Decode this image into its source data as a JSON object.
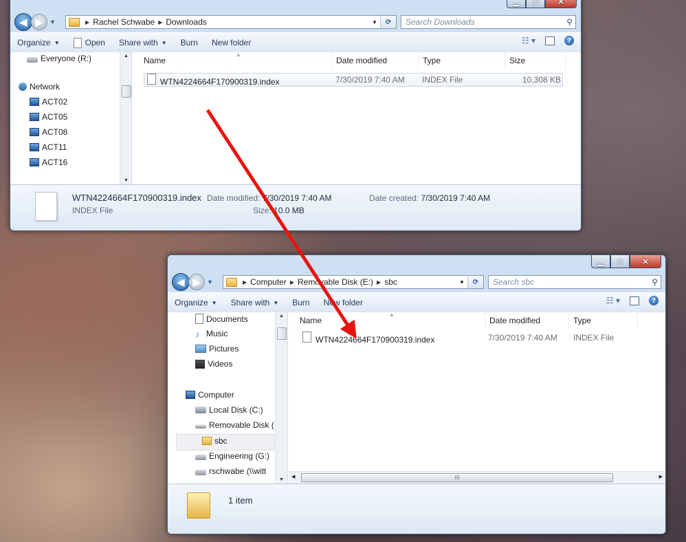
{
  "downloads_window": {
    "address": {
      "parts": [
        "Rachel Schwabe",
        "Downloads"
      ]
    },
    "search_placeholder": "Search Downloads",
    "toolbar": {
      "organize": "Organize",
      "open": "Open",
      "share_with": "Share with",
      "burn": "Burn",
      "new_folder": "New folder"
    },
    "nav_items": [
      {
        "label": "Everyone (R:)",
        "icon": "network-drive-icon"
      },
      {
        "label": "Network",
        "icon": "network-icon"
      },
      {
        "label": "ACT02",
        "icon": "computer-icon"
      },
      {
        "label": "ACT05",
        "icon": "computer-icon"
      },
      {
        "label": "ACT08",
        "icon": "computer-icon"
      },
      {
        "label": "ACT11",
        "icon": "computer-icon"
      },
      {
        "label": "ACT16",
        "icon": "computer-icon"
      }
    ],
    "columns": {
      "name": "Name",
      "date_modified": "Date modified",
      "type": "Type",
      "size": "Size"
    },
    "files": [
      {
        "name": "WTN4224664F170900319.index",
        "date_modified": "7/30/2019 7:40 AM",
        "type": "INDEX File",
        "size": "10,308 KB"
      }
    ],
    "details": {
      "name": "WTN4224664F170900319.index",
      "type": "INDEX File",
      "date_modified_label": "Date modified:",
      "date_modified_value": "7/30/2019 7:40 AM",
      "date_created_label": "Date created:",
      "date_created_value": "7/30/2019 7:40 AM",
      "size_label": "Size:",
      "size_value": "10.0 MB"
    }
  },
  "sbc_window": {
    "address": {
      "parts": [
        "Computer",
        "Removable Disk (E:)",
        "sbc"
      ]
    },
    "search_placeholder": "Search sbc",
    "toolbar": {
      "organize": "Organize",
      "share_with": "Share with",
      "burn": "Burn",
      "new_folder": "New folder"
    },
    "nav_items": [
      {
        "label": "Documents",
        "icon": "documents-icon"
      },
      {
        "label": "Music",
        "icon": "music-icon"
      },
      {
        "label": "Pictures",
        "icon": "pictures-icon"
      },
      {
        "label": "Videos",
        "icon": "videos-icon"
      },
      {
        "label": "Computer",
        "icon": "computer-icon"
      },
      {
        "label": "Local Disk (C:)",
        "icon": "local-disk-icon"
      },
      {
        "label": "Removable Disk (",
        "icon": "removable-disk-icon"
      },
      {
        "label": "sbc",
        "icon": "folder-icon"
      },
      {
        "label": "Engineering (G:)",
        "icon": "network-drive-icon"
      },
      {
        "label": "rschwabe (\\\\witt",
        "icon": "network-drive-icon"
      }
    ],
    "columns": {
      "name": "Name",
      "date_modified": "Date modified",
      "type": "Type"
    },
    "files": [
      {
        "name": "WTN4224664F170900319.index",
        "date_modified": "7/30/2019 7:40 AM",
        "type": "INDEX File"
      }
    ],
    "item_count": "1 item"
  },
  "annotation": {
    "arrow_color": "#e8140f"
  }
}
